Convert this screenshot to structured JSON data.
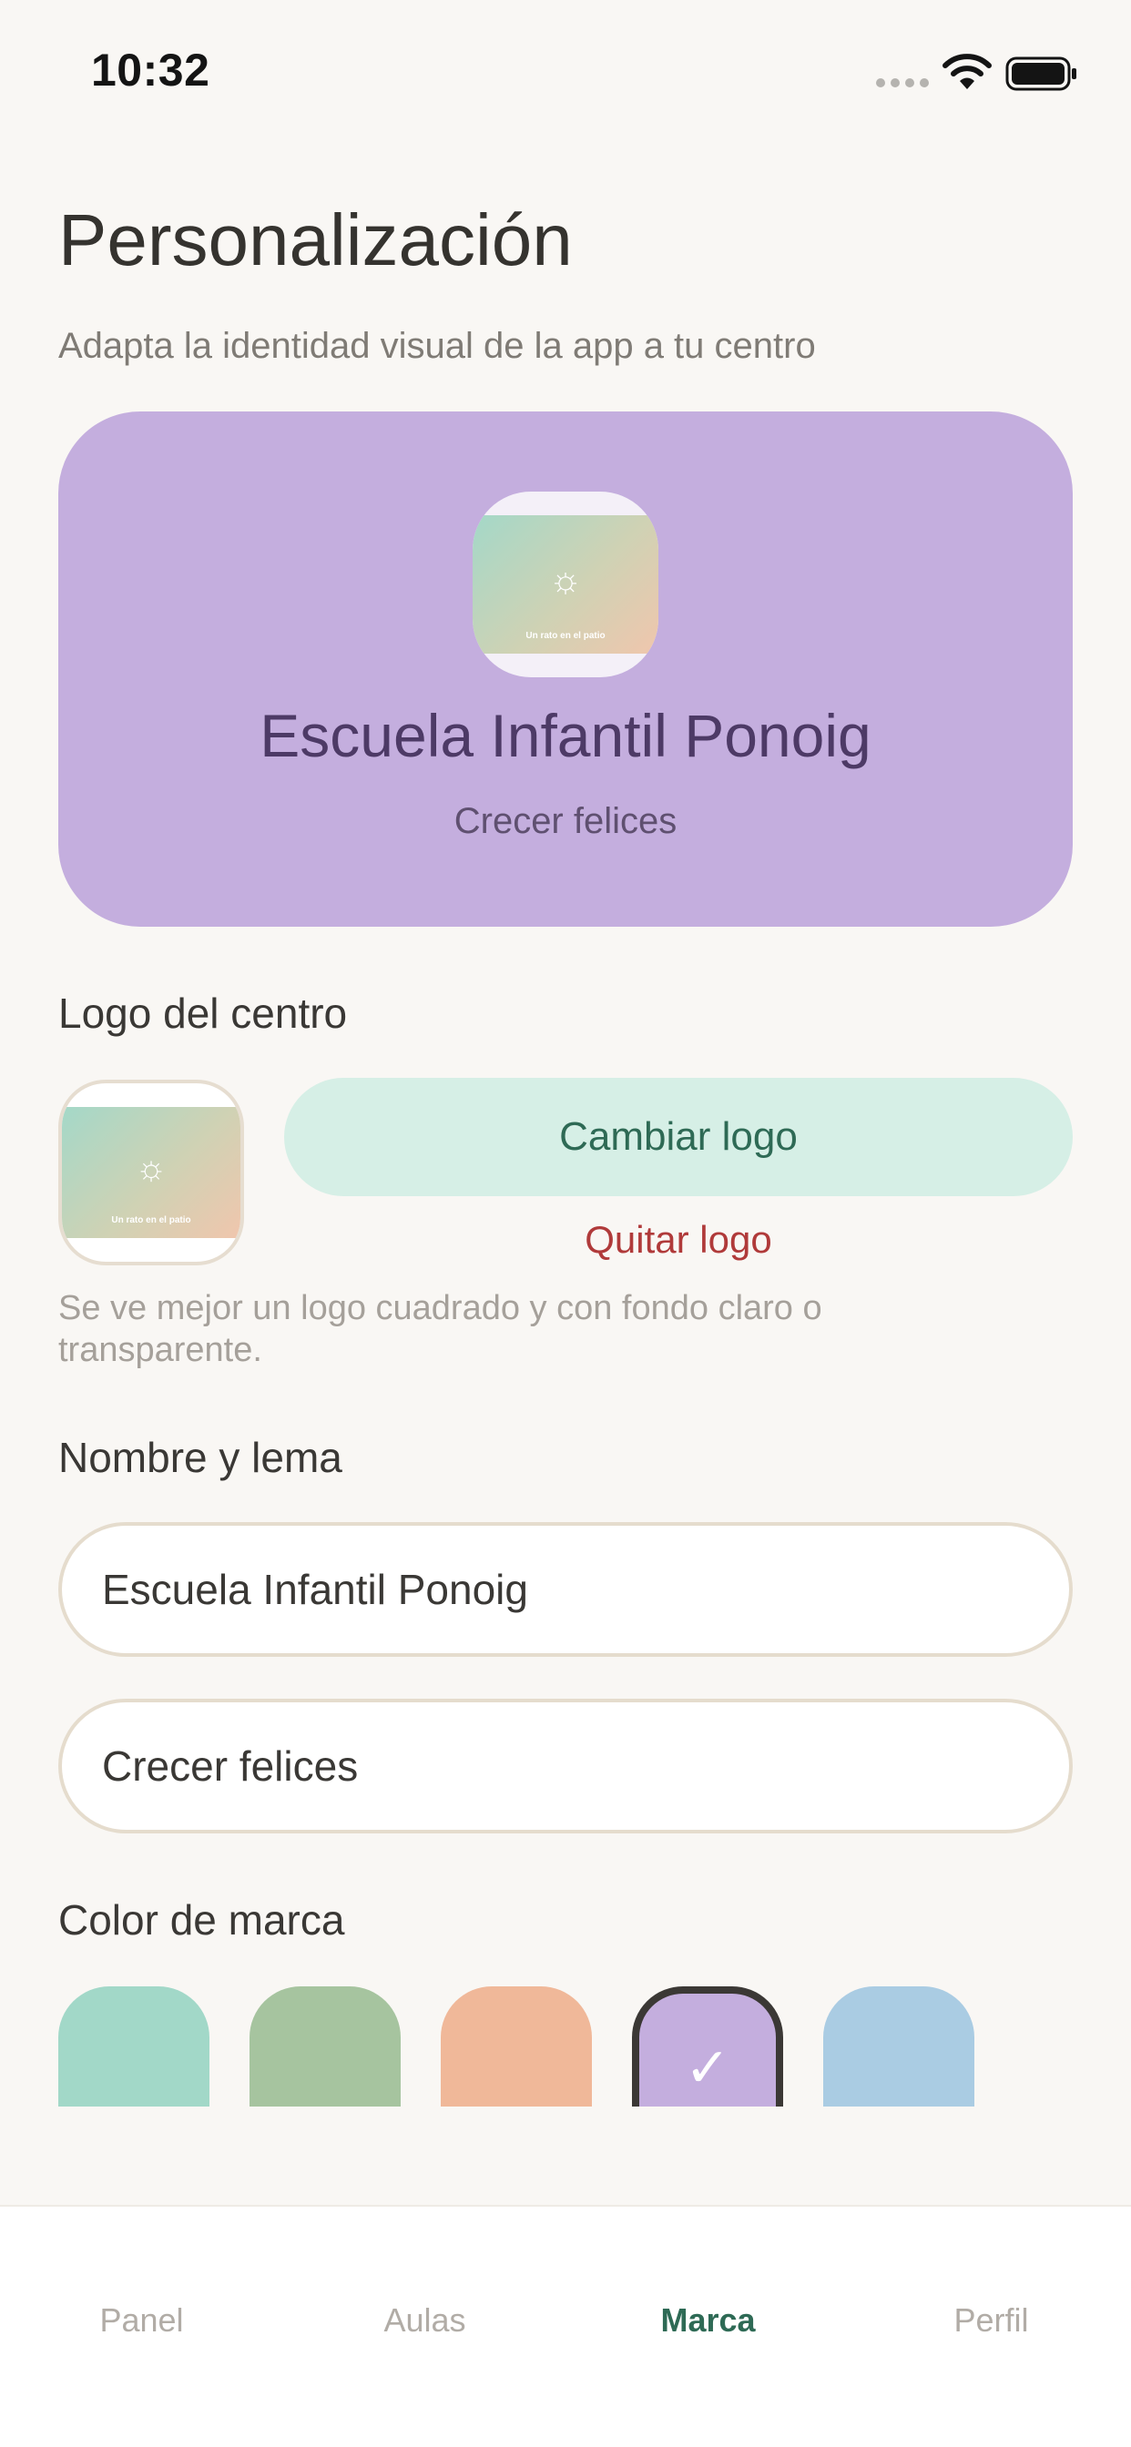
{
  "status_bar": {
    "time": "10:32"
  },
  "header": {
    "title": "Personalización",
    "subtitle": "Adapta la identidad visual de la app a tu centro"
  },
  "preview": {
    "school_name": "Escuela Infantil Ponoig",
    "slogan": "Crecer felices",
    "logo_caption": "Un rato en el patio",
    "background_color": "#c4aede"
  },
  "logo_section": {
    "label": "Logo del centro",
    "logo_caption": "Un rato en el patio",
    "change_label": "Cambiar logo",
    "remove_label": "Quitar logo",
    "hint": "Se ve mejor un logo cuadrado y con fondo claro o transparente."
  },
  "name_section": {
    "label": "Nombre y lema",
    "name_value": "Escuela Infantil Ponoig",
    "slogan_value": "Crecer felices"
  },
  "color_section": {
    "label": "Color de marca",
    "swatches": [
      {
        "color": "#a2d8c8",
        "selected": false
      },
      {
        "color": "#a6c49f",
        "selected": false
      },
      {
        "color": "#f0b899",
        "selected": false
      },
      {
        "color": "#c4aede",
        "selected": true
      },
      {
        "color": "#aacce3",
        "selected": false
      }
    ]
  },
  "tab_bar": {
    "tabs": [
      {
        "label": "Panel",
        "active": false
      },
      {
        "label": "Aulas",
        "active": false
      },
      {
        "label": "Marca",
        "active": true
      },
      {
        "label": "Perfil",
        "active": false
      }
    ]
  },
  "colors": {
    "accent": "#2e6a55",
    "danger": "#b03a3a",
    "background": "#f9f7f4"
  }
}
